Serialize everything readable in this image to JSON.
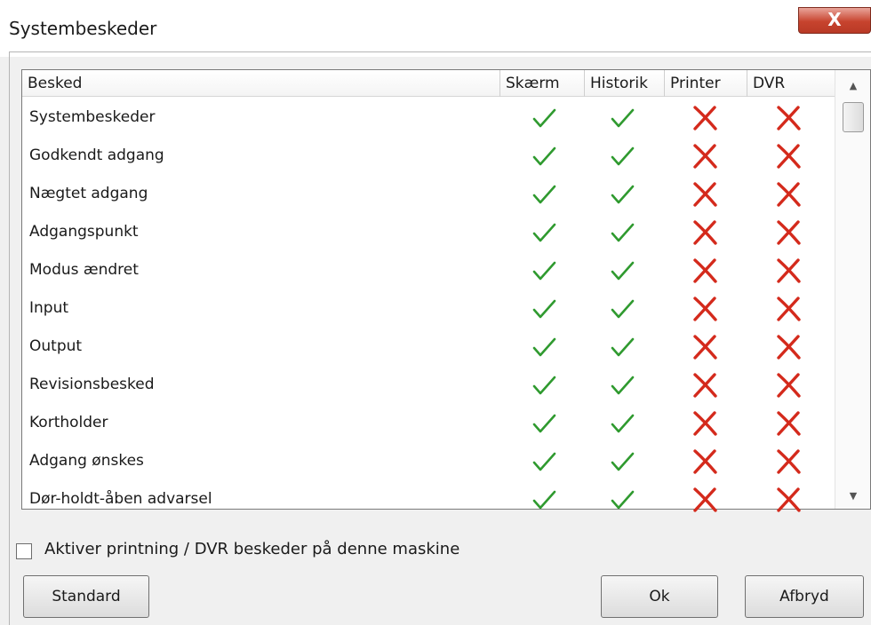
{
  "window": {
    "title": "Systembeskeder",
    "close_label": "X"
  },
  "table": {
    "columns": [
      "Besked",
      "Skærm",
      "Historik",
      "Printer",
      "DVR"
    ],
    "rows": [
      {
        "label": "Systembeskeder",
        "values": [
          true,
          true,
          false,
          false
        ]
      },
      {
        "label": "Godkendt adgang",
        "values": [
          true,
          true,
          false,
          false
        ]
      },
      {
        "label": "Nægtet adgang",
        "values": [
          true,
          true,
          false,
          false
        ]
      },
      {
        "label": "Adgangspunkt",
        "values": [
          true,
          true,
          false,
          false
        ]
      },
      {
        "label": "Modus ændret",
        "values": [
          true,
          true,
          false,
          false
        ]
      },
      {
        "label": "Input",
        "values": [
          true,
          true,
          false,
          false
        ]
      },
      {
        "label": "Output",
        "values": [
          true,
          true,
          false,
          false
        ]
      },
      {
        "label": "Revisionsbesked",
        "values": [
          true,
          true,
          false,
          false
        ]
      },
      {
        "label": "Kortholder",
        "values": [
          true,
          true,
          false,
          false
        ]
      },
      {
        "label": "Adgang ønskes",
        "values": [
          true,
          true,
          false,
          false
        ]
      },
      {
        "label": "Dør-holdt-åben advarsel",
        "values": [
          true,
          true,
          false,
          false
        ]
      }
    ]
  },
  "checkbox": {
    "label": "Aktiver printning / DVR beskeder på denne maskine",
    "checked": false
  },
  "buttons": {
    "standard": "Standard",
    "ok": "Ok",
    "cancel": "Afbryd"
  },
  "icons": {
    "check": "check-icon",
    "cross": "cross-icon"
  },
  "colors": {
    "check": "#2f9a2f",
    "cross": "#d42a1c",
    "close_button": "#c7432e"
  }
}
